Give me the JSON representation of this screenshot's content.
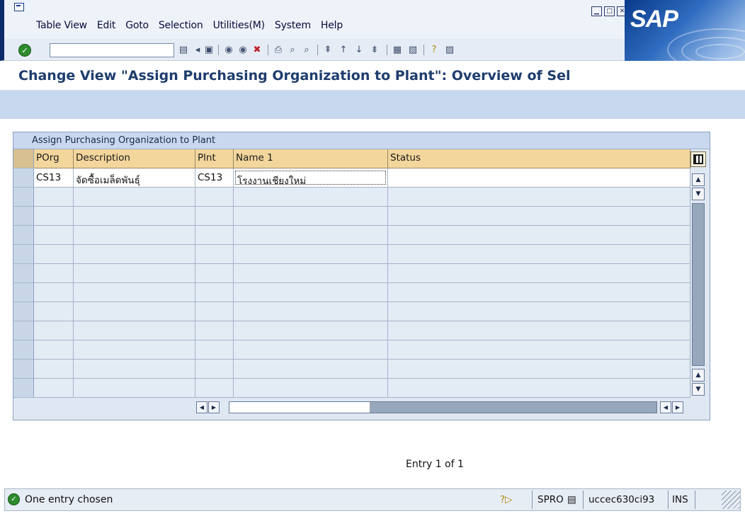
{
  "menubar": {
    "items": [
      "Table View",
      "Edit",
      "Goto",
      "Selection",
      "Utilities(M)",
      "System",
      "Help"
    ]
  },
  "logo": {
    "text": "SAP"
  },
  "page_title": "Change View \"Assign Purchasing Organization to Plant\": Overview of Sel",
  "table": {
    "title": "Assign Purchasing Organization to Plant",
    "columns": [
      "POrg",
      "Description",
      "Plnt",
      "Name 1",
      "Status"
    ],
    "rows": [
      {
        "porg": "CS13",
        "description": "จัดซื้อเมล็ดพันธุ์",
        "plnt": "CS13",
        "name1": "โรงงานเชียงใหม่",
        "status": ""
      }
    ]
  },
  "entry_info": "Entry 1 of 1",
  "statusbar": {
    "message": "One entry chosen",
    "transaction": "SPRO",
    "server": "uccec630ci93",
    "mode": "INS"
  },
  "colors": {
    "header_bg": "#f3d69c",
    "appbar_bg": "#c7d7ee",
    "title_color": "#1e3d6e"
  }
}
